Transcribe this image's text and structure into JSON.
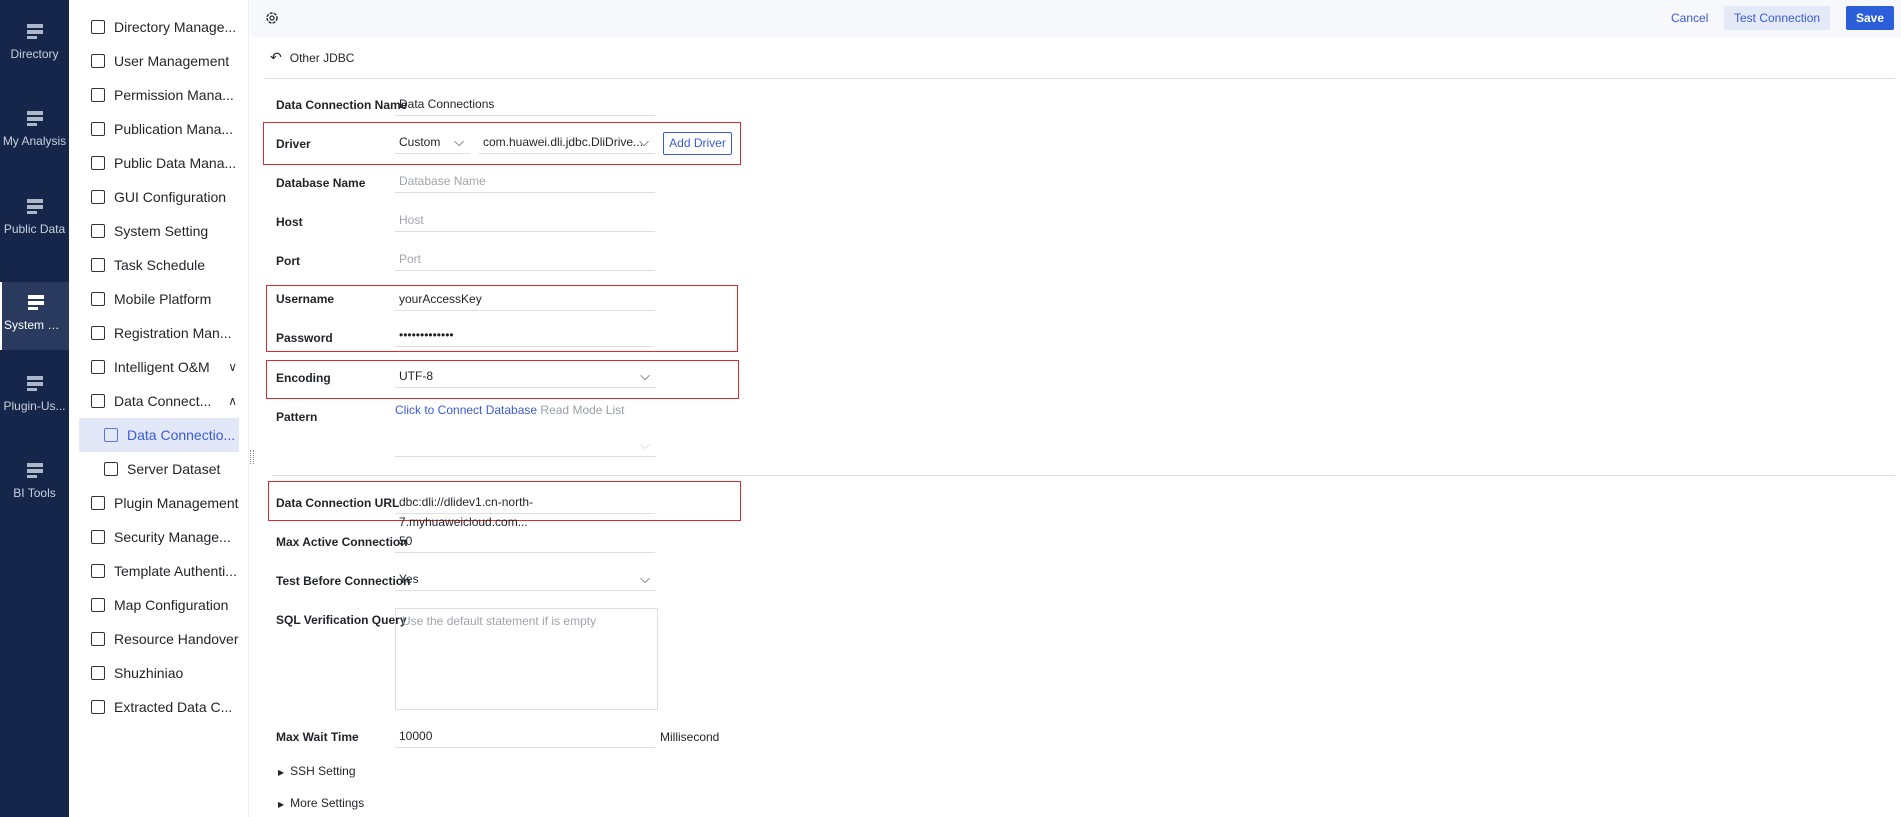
{
  "nav": [
    {
      "label": "Directory",
      "icon": "directory-icon"
    },
    {
      "label": "My Analysis",
      "icon": "analysis-icon"
    },
    {
      "label": "Public Data",
      "icon": "public-data-icon"
    },
    {
      "label": "System M...",
      "icon": "system-gear-icon",
      "active": true
    },
    {
      "label": "Plugin-Us...",
      "icon": "plugin-user-icon"
    },
    {
      "label": "BI Tools",
      "icon": "toolbox-icon"
    }
  ],
  "menu": [
    {
      "label": "Directory Manage..."
    },
    {
      "label": "User Management"
    },
    {
      "label": "Permission Mana..."
    },
    {
      "label": "Publication Mana..."
    },
    {
      "label": "Public Data Mana..."
    },
    {
      "label": "GUI Configuration"
    },
    {
      "label": "System Setting"
    },
    {
      "label": "Task Schedule"
    },
    {
      "label": "Mobile Platform"
    },
    {
      "label": "Registration Man..."
    },
    {
      "label": "Intelligent O&M",
      "chevron": "∨"
    },
    {
      "label": "Data Connect...",
      "chevron": "∧"
    },
    {
      "label": "Data Connectio...",
      "sub": true,
      "active": true
    },
    {
      "label": "Server Dataset",
      "sub": true
    },
    {
      "label": "Plugin Management"
    },
    {
      "label": "Security Manage..."
    },
    {
      "label": "Template Authenti..."
    },
    {
      "label": "Map Configuration"
    },
    {
      "label": "Resource Handover"
    },
    {
      "label": "Shuzhiniao"
    },
    {
      "label": "Extracted Data C..."
    }
  ],
  "toolbar": {
    "cancel": "Cancel",
    "test": "Test Connection",
    "save": "Save"
  },
  "header": {
    "back_label": "Other JDBC"
  },
  "form": {
    "name_label": "Data Connection Name",
    "name_value": "Data Connections",
    "driver_label": "Driver",
    "driver_type": "Custom",
    "driver_class": "com.huawei.dli.jdbc.DliDrive...",
    "add_driver": "Add Driver",
    "db_label": "Database Name",
    "db_placeholder": "Database Name",
    "host_label": "Host",
    "host_placeholder": "Host",
    "port_label": "Port",
    "port_placeholder": "Port",
    "user_label": "Username",
    "user_value": "yourAccessKey",
    "pass_label": "Password",
    "pass_value": "•••••••••••••",
    "enc_label": "Encoding",
    "enc_value": "UTF-8",
    "pattern_label": "Pattern",
    "pattern_link": "Click to Connect Database",
    "pattern_hint": "Read Mode List",
    "url_label": "Data Connection URL",
    "url_value": "dbc:dli://dlidev1.cn-north-7.myhuaweicloud.com...",
    "max_active_label": "Max Active Connection",
    "max_active_value": "50",
    "test_before_label": "Test Before Connection",
    "test_before_value": "Yes",
    "sql_label": "SQL Verification Query",
    "sql_placeholder": "Use the default statement if is empty",
    "max_wait_label": "Max Wait Time",
    "max_wait_value": "10000",
    "max_wait_unit": "Millisecond",
    "ssh": "SSH Setting",
    "more": "More Settings"
  },
  "colors": {
    "nav_bg": "#16264a",
    "accent": "#2b5fd9",
    "highlight": "#e0282d"
  }
}
